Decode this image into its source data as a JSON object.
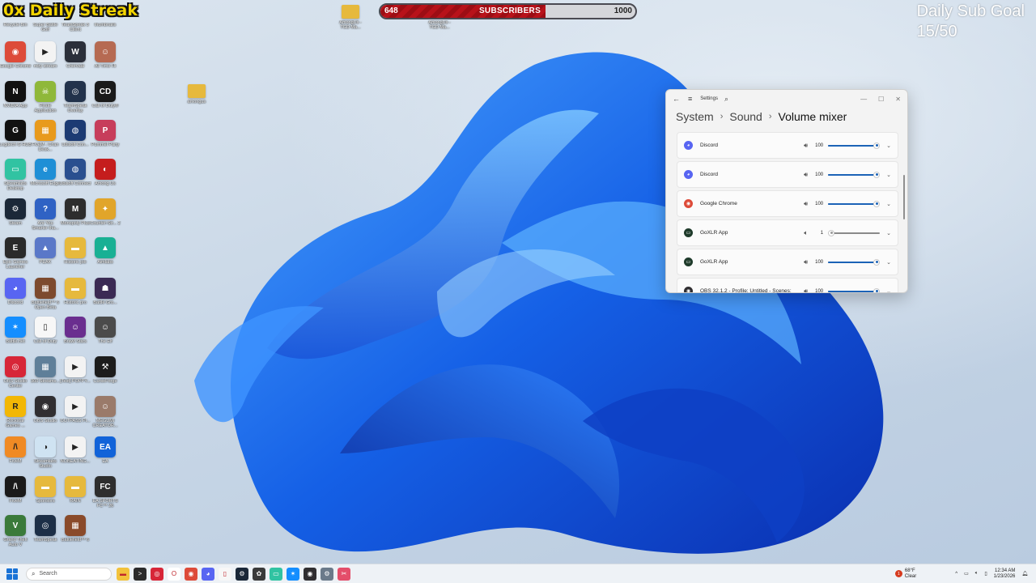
{
  "overlay": {
    "streak": "0x Daily Streak",
    "subscribers": {
      "label": "SUBSCRIBERS",
      "current": "648",
      "target": "1000",
      "progress": 0.648
    },
    "goal_title": "Daily Sub Goal",
    "goal_value": "15/50"
  },
  "top_folders": [
    {
      "label": "AmongUs - TGD Ma..."
    },
    {
      "label": "AmongUs - TGD Ma..."
    }
  ],
  "desktop_folder": {
    "label": "amongus"
  },
  "desktop_icons": [
    {
      "label": "Recycle Bin",
      "icon": "recycle-bin-icon",
      "color": "#6a8fb5",
      "glyph": "♻"
    },
    {
      "label": "Super Battle Golf",
      "icon": "golf-icon",
      "color": "#4c9a44",
      "glyph": "⛳"
    },
    {
      "label": "TeamSpeak 3 Client",
      "icon": "teamspeak-icon",
      "color": "#25406b",
      "glyph": "TS"
    },
    {
      "label": "thumbnails",
      "icon": "folder-icon",
      "color": "#6b5a3a",
      "glyph": "▣"
    },
    {
      "label": "Google Chrome",
      "icon": "chrome-icon",
      "color": "#dd4b39",
      "glyph": "◉"
    },
    {
      "label": "mby stream",
      "icon": "media-icon",
      "color": "#f3f3f3",
      "glyph": "▶"
    },
    {
      "label": "Chervaal",
      "icon": "wolf-icon",
      "color": "#2b2f3a",
      "glyph": "W"
    },
    {
      "label": "All Time Hi",
      "icon": "avatar-icon",
      "color": "#b66a52",
      "glyph": "☺"
    },
    {
      "label": "NVIDIA App",
      "icon": "nvidia-icon",
      "color": "#111111",
      "glyph": "N"
    },
    {
      "label": "Pirate Application",
      "icon": "pirate-icon",
      "color": "#8fb83a",
      "glyph": "☠"
    },
    {
      "label": "TeamSpeak Overlay",
      "icon": "headset-icon",
      "color": "#22324b",
      "glyph": "◎"
    },
    {
      "label": "Call of Duty®",
      "icon": "cod-icon",
      "color": "#1a1a1a",
      "glyph": "CD"
    },
    {
      "label": "Logitech G HUB",
      "icon": "logitech-icon",
      "color": "#111111",
      "glyph": "G"
    },
    {
      "label": "FiveM - Chan Desk...",
      "icon": "box-icon",
      "color": "#e89a1c",
      "glyph": "▦"
    },
    {
      "label": "Ubisoft Con...",
      "icon": "ubisoft-icon",
      "color": "#1c3b73",
      "glyph": "◍"
    },
    {
      "label": "Pummel Party",
      "icon": "party-icon",
      "color": "#c73d5b",
      "glyph": "P"
    },
    {
      "label": "Streamlabs Desktop",
      "icon": "streamlabs-icon",
      "color": "#31c3a2",
      "glyph": "▭"
    },
    {
      "label": "Microsoft Edge",
      "icon": "edge-icon",
      "color": "#1f8fd6",
      "glyph": "e"
    },
    {
      "label": "Ubisoft Connect",
      "icon": "ubisoft-swirl-icon",
      "color": "#2a4f8f",
      "glyph": "◍"
    },
    {
      "label": "Among Us",
      "icon": "amongus-icon",
      "color": "#c51d1d",
      "glyph": "◐"
    },
    {
      "label": "Steam",
      "icon": "steam-icon",
      "color": "#1b2838",
      "glyph": "⚙"
    },
    {
      "label": "Are You Smarter tha...",
      "icon": "quiz-icon",
      "color": "#2f62c4",
      "glyph": "?"
    },
    {
      "label": "Monopoly Plus",
      "icon": "monopoly-icon",
      "color": "#2d2d2d",
      "glyph": "M"
    },
    {
      "label": "Counter-Str... 2",
      "icon": "cs2-icon",
      "color": "#e1a52a",
      "glyph": "✦"
    },
    {
      "label": "Epic Games Launcher",
      "icon": "epic-icon",
      "color": "#2a2a2a",
      "glyph": "E"
    },
    {
      "label": "PEAK",
      "icon": "mountain-icon",
      "color": "#5a78c8",
      "glyph": "▲"
    },
    {
      "label": "Historic job",
      "icon": "folder-icon",
      "color": "#e6b93d",
      "glyph": "▬"
    },
    {
      "label": "Aimlabs",
      "icon": "aimlabs-icon",
      "color": "#19b094",
      "glyph": "▲"
    },
    {
      "label": "Discord",
      "icon": "discord-icon",
      "color": "#5865f2",
      "glyph": "◕"
    },
    {
      "label": "Battlefield™ 6 Open Beta",
      "icon": "battlefield-icon",
      "color": "#7d4a2e",
      "glyph": "▦"
    },
    {
      "label": "Historic pro",
      "icon": "folder-icon",
      "color": "#e6b93d",
      "glyph": "▬"
    },
    {
      "label": "Battle Gro...",
      "icon": "battle-icon",
      "color": "#3b2a54",
      "glyph": "☗"
    },
    {
      "label": "Battle.net",
      "icon": "battlenet-icon",
      "color": "#148eff",
      "glyph": "✶"
    },
    {
      "label": "Call of Duty",
      "icon": "document-icon",
      "color": "#f7f7f7",
      "glyph": "▯"
    },
    {
      "label": "Brawl Stars",
      "icon": "brawl-icon",
      "color": "#6a2e8f",
      "glyph": "☺"
    },
    {
      "label": "The Elf",
      "icon": "portrait-icon",
      "color": "#4b4b4b",
      "glyph": "☺"
    },
    {
      "label": "OBS Studio Center",
      "icon": "obs-red-icon",
      "color": "#d72638",
      "glyph": "◎"
    },
    {
      "label": "360 Streams...",
      "icon": "stream-icon",
      "color": "#5f7f99",
      "glyph": "▦"
    },
    {
      "label": "[Test] POPPY...",
      "icon": "media-icon",
      "color": "#f3f3f3",
      "glyph": "▶"
    },
    {
      "label": "CurseForge",
      "icon": "anvil-icon",
      "color": "#1c1c1c",
      "glyph": "⚒"
    },
    {
      "label": "Rockstar Games ...",
      "icon": "rockstar-icon",
      "color": "#f2b705",
      "glyph": "R"
    },
    {
      "label": "OBS Studio",
      "icon": "obs-icon",
      "color": "#302e31",
      "glyph": "◉"
    },
    {
      "label": "OUTPASS Pl...",
      "icon": "media-icon",
      "color": "#f3f3f3",
      "glyph": "▶"
    },
    {
      "label": "MEGUMI CREATOR...",
      "icon": "portrait-icon",
      "color": "#9a7a6a",
      "glyph": "☺"
    },
    {
      "label": "FiveM",
      "icon": "fivem-icon",
      "color": "#f08a24",
      "glyph": "/\\"
    },
    {
      "label": "Streamlabs Studio",
      "icon": "streamlabs-icon",
      "color": "#cfe3f2",
      "glyph": "◑"
    },
    {
      "label": "NOBEATING...",
      "icon": "media-icon",
      "color": "#f3f3f3",
      "glyph": "▶"
    },
    {
      "label": "EA",
      "icon": "ea-icon",
      "color": "#1163d9",
      "glyph": "EA"
    },
    {
      "label": "FiveM",
      "icon": "fivem-icon",
      "color": "#1a1a1a",
      "glyph": "/\\"
    },
    {
      "label": "Sponsors",
      "icon": "folder-icon",
      "color": "#e6b93d",
      "glyph": "▬"
    },
    {
      "label": "RAIN",
      "icon": "folder-icon",
      "color": "#e6b93d",
      "glyph": "▬"
    },
    {
      "label": "EA SPORTS FC™ 26",
      "icon": "fc-icon",
      "color": "#2e2e2e",
      "glyph": "FC"
    },
    {
      "label": "Grand Theft Auto V",
      "icon": "gta-icon",
      "color": "#3a7a3a",
      "glyph": "V"
    },
    {
      "label": "TeamSpeak",
      "icon": "teamspeak-icon",
      "color": "#1d2f47",
      "glyph": "◎"
    },
    {
      "label": "Battlefield™ 6",
      "icon": "battlefield-icon",
      "color": "#8a4a2a",
      "glyph": "▦"
    }
  ],
  "settings": {
    "window_title": "Settings",
    "breadcrumb": [
      "System",
      "Sound",
      "Volume mixer"
    ],
    "apps": [
      {
        "name": "Discord",
        "volume": "100",
        "level": 1.0,
        "icon": "discord-icon",
        "color": "#5865f2",
        "glyph": "◕"
      },
      {
        "name": "Discord",
        "volume": "100",
        "level": 1.0,
        "icon": "discord-icon",
        "color": "#5865f2",
        "glyph": "◕"
      },
      {
        "name": "Google Chrome",
        "volume": "100",
        "level": 1.0,
        "icon": "chrome-icon",
        "color": "#dd4b39",
        "glyph": "◉"
      },
      {
        "name": "GoXLR App",
        "volume": "1",
        "level": 0.01,
        "icon": "goxlr-icon",
        "color": "#1f3b2b",
        "glyph": "▭"
      },
      {
        "name": "GoXLR App",
        "volume": "100",
        "level": 1.0,
        "icon": "goxlr-icon",
        "color": "#1f3b2b",
        "glyph": "▭"
      },
      {
        "name": "OBS 32.1.2 - Profile: Untitled - Scenes:",
        "volume": "100",
        "level": 1.0,
        "icon": "obs-icon",
        "color": "#302e31",
        "glyph": "◉"
      }
    ]
  },
  "taskbar": {
    "search_placeholder": "Search",
    "apps": [
      {
        "icon": "file-explorer-icon",
        "color": "#f2c23b",
        "glyph": "▬"
      },
      {
        "icon": "terminal-icon",
        "color": "#2b2b2b",
        "glyph": ">"
      },
      {
        "icon": "obs-red-icon",
        "color": "#d72638",
        "glyph": "◎"
      },
      {
        "icon": "opera-icon",
        "color": "#ffffff",
        "glyph": "O"
      },
      {
        "icon": "chrome-icon",
        "color": "#dd4b39",
        "glyph": "◉"
      },
      {
        "icon": "discord-icon",
        "color": "#5865f2",
        "glyph": "◕"
      },
      {
        "icon": "document-icon",
        "color": "#f7f7f7",
        "glyph": "▯"
      },
      {
        "icon": "steam-icon",
        "color": "#1b2838",
        "glyph": "⚙"
      },
      {
        "icon": "davinci-icon",
        "color": "#3a3a3a",
        "glyph": "✿"
      },
      {
        "icon": "streamlabs-icon",
        "color": "#31c3a2",
        "glyph": "▭"
      },
      {
        "icon": "battlenet-icon",
        "color": "#148eff",
        "glyph": "✶"
      },
      {
        "icon": "obs-icon",
        "color": "#302e31",
        "glyph": "◉"
      },
      {
        "icon": "settings-icon",
        "color": "#6b7a8a",
        "glyph": "⚙"
      },
      {
        "icon": "snipping-icon",
        "color": "#e44e6a",
        "glyph": "✂"
      }
    ],
    "weather_temp": "68°F",
    "weather_desc": "Clear",
    "time": "12:34 AM",
    "date": "1/23/2026"
  }
}
